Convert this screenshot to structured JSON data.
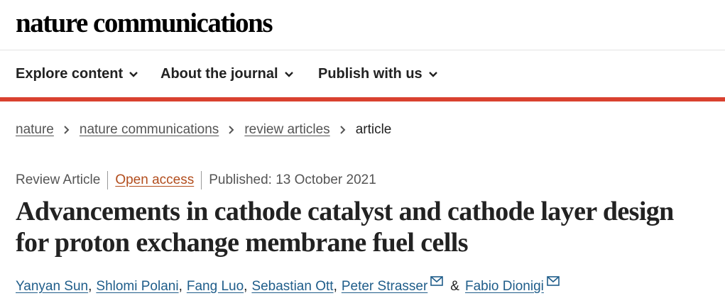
{
  "header": {
    "logo": "nature communications"
  },
  "nav": {
    "items": [
      {
        "label": "Explore content"
      },
      {
        "label": "About the journal"
      },
      {
        "label": "Publish with us"
      }
    ]
  },
  "breadcrumb": {
    "items": [
      "nature",
      "nature communications",
      "review articles"
    ],
    "current": "article"
  },
  "article": {
    "type": "Review Article",
    "access": "Open access",
    "published": "Published: 13 October 2021",
    "title": "Advancements in cathode catalyst and cathode layer design for proton exchange membrane fuel cells",
    "authors": [
      "Yanyan Sun",
      "Shlomi Polani",
      "Fang Luo",
      "Sebastian Ott",
      "Peter Strasser",
      "Fabio Dionigi"
    ],
    "amp": "&"
  },
  "colors": {
    "accent_red": "#d9412f",
    "link_blue": "#1f5d8a",
    "open_access": "#b24d1d"
  }
}
